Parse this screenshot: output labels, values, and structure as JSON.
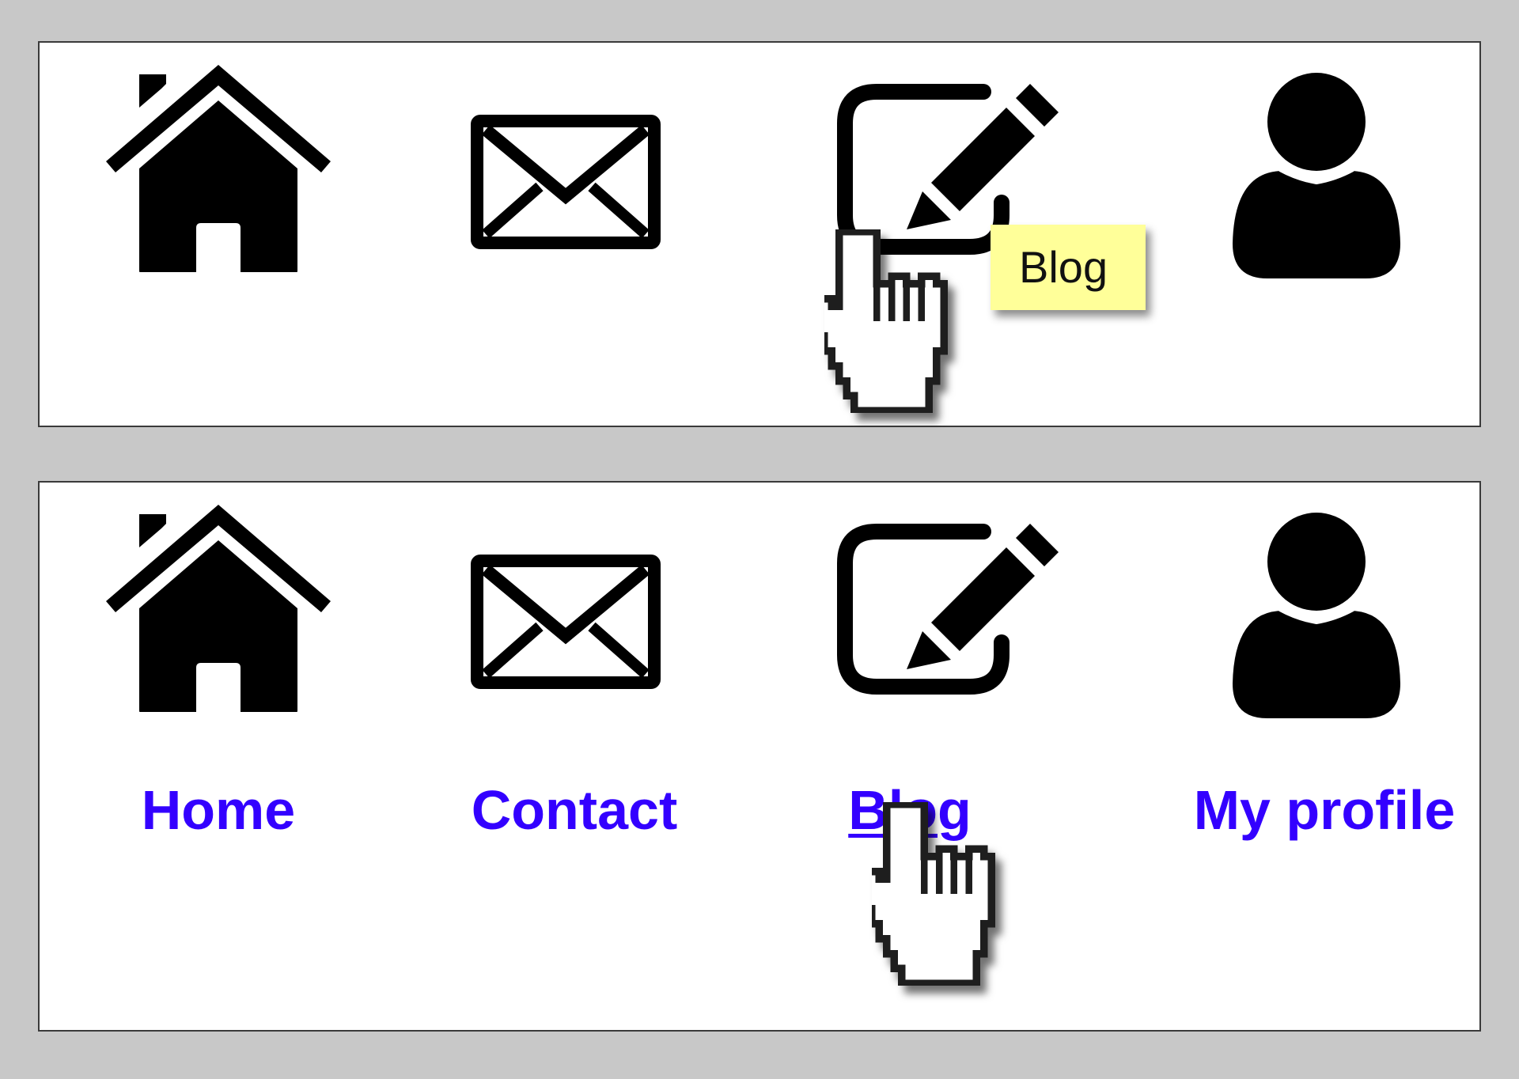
{
  "icon_nav": {
    "items": [
      {
        "key": "home",
        "icon": "house-icon"
      },
      {
        "key": "contact",
        "icon": "envelope-icon"
      },
      {
        "key": "blog",
        "icon": "edit-pencil-icon"
      },
      {
        "key": "profile",
        "icon": "user-icon"
      }
    ],
    "tooltip": "Blog",
    "hovered": "blog"
  },
  "labeled_nav": {
    "items": [
      {
        "key": "home",
        "icon": "house-icon",
        "label": "Home"
      },
      {
        "key": "contact",
        "icon": "envelope-icon",
        "label": "Contact"
      },
      {
        "key": "blog",
        "icon": "edit-pencil-icon",
        "label": "Blog"
      },
      {
        "key": "profile",
        "icon": "user-icon",
        "label": "My profile"
      }
    ],
    "hovered": "blog"
  },
  "colors": {
    "background": "#c8c8c8",
    "panel": "#ffffff",
    "link": "#3300ff",
    "tooltip": "#ffff99",
    "icon": "#000000"
  }
}
